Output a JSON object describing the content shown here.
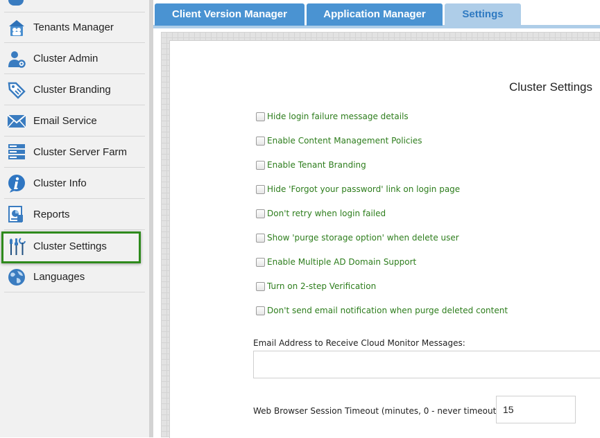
{
  "sidebar": {
    "items": [
      {
        "label": "Tenants Manager",
        "icon": "tenants-icon"
      },
      {
        "label": "Cluster Admin",
        "icon": "cluster-admin-icon"
      },
      {
        "label": "Cluster Branding",
        "icon": "branding-tag-icon"
      },
      {
        "label": "Email Service",
        "icon": "envelope-icon"
      },
      {
        "label": "Cluster Server Farm",
        "icon": "server-farm-icon"
      },
      {
        "label": "Cluster Info",
        "icon": "info-icon"
      },
      {
        "label": "Reports",
        "icon": "reports-icon"
      },
      {
        "label": "Cluster Settings",
        "icon": "settings-tools-icon",
        "active": true
      },
      {
        "label": "Languages",
        "icon": "globe-icon"
      }
    ]
  },
  "tabs": [
    {
      "label": "Client Version Manager"
    },
    {
      "label": "Application Manager"
    },
    {
      "label": "Settings",
      "active": true
    }
  ],
  "main": {
    "title": "Cluster Settings",
    "options": [
      {
        "label": "Hide login failure message details",
        "checked": false
      },
      {
        "label": "Enable Content Management Policies",
        "checked": false
      },
      {
        "label": "Enable Tenant Branding",
        "checked": false
      },
      {
        "label": "Hide 'Forgot your password' link on login page",
        "checked": false
      },
      {
        "label": "Don't retry when login failed",
        "checked": false
      },
      {
        "label": "Show 'purge storage option' when delete user",
        "checked": false
      },
      {
        "label": "Enable Multiple AD Domain Support",
        "checked": false
      },
      {
        "label": "Turn on 2-step Verification",
        "checked": false
      },
      {
        "label": "Don't send email notification when purge deleted content",
        "checked": false
      }
    ],
    "email_label": "Email Address to Receive Cloud Monitor Messages:",
    "email_value": "",
    "timeout_label": "Web Browser Session Timeout (minutes, 0 - never timeout):",
    "timeout_value": "15"
  },
  "colors": {
    "tab_blue": "#4a93d2",
    "tab_active": "#aecde8",
    "option_green": "#2d7d1c",
    "active_border": "#2e8a1c"
  }
}
